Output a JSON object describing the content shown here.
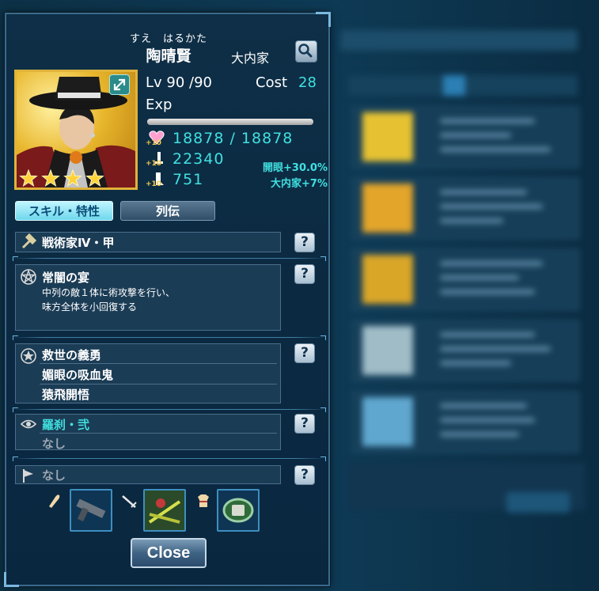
{
  "character": {
    "reading": "すえ　はるかた",
    "name": "陶晴賢",
    "faction": "大内家",
    "level_text": "Lv 90 /90",
    "cost_label": "Cost",
    "cost_value": "28",
    "exp_label": "Exp",
    "exp_progress": 1.0,
    "hp_text": "18878 / 18878",
    "attack": "22340",
    "defense": "751",
    "bonus_open": "開眼+30.0%",
    "bonus_faction": "大内家+7%",
    "plus_badge": "+10",
    "rarity_stars": 4
  },
  "tabs": {
    "skills": "スキル・特性",
    "biography": "列伝"
  },
  "rows": {
    "tactic": "戦術家Ⅳ・甲",
    "skill_name": "常闇の宴",
    "skill_desc_line1": "中列の敵１体に術攻撃を行い、",
    "skill_desc_line2": "味方全体を小回復する",
    "trait1": "救世の義勇",
    "trait2": "媚眼の吸血鬼",
    "trait3": "猿飛開悟",
    "eye_title": "羅刹・弐",
    "eye_value": "なし",
    "flag_value": "なし",
    "help": "?"
  },
  "close_label": "Close",
  "icons": {
    "search": "search-icon",
    "expand": "expand-icon",
    "help": "question-icon",
    "tactic": "hammer-icon",
    "skill": "pentagram-icon",
    "trait": "star-badge-icon",
    "eye": "eye-icon",
    "flag": "flag-icon",
    "weapon_slot": "bullet-icon",
    "blade_slot": "blade-icon",
    "armor_slot": "armor-icon"
  },
  "colors": {
    "accent_cyan": "#40e0e0",
    "panel_bg": "#0c2c44",
    "gold": "#e0b33a"
  }
}
